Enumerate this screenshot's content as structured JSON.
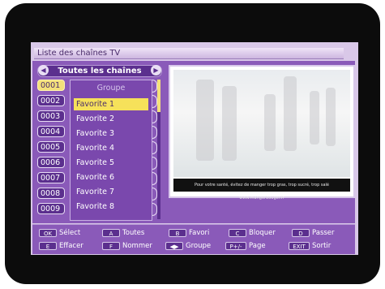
{
  "window": {
    "title": "Liste des chaînes TV"
  },
  "list_header": {
    "title": "Toutes les chaînes",
    "left_arrow": "◀",
    "right_arrow": "▶"
  },
  "channels": [
    "0001",
    "0002",
    "0003",
    "0004",
    "0005",
    "0006",
    "0007",
    "0008",
    "0009"
  ],
  "group_menu": {
    "title": "Groupe",
    "items": [
      "Favorite 1",
      "Favorite 2",
      "Favorite 3",
      "Favorite 4",
      "Favorite 5",
      "Favorite 6",
      "Favorite 7",
      "Favorite 8"
    ],
    "selected": "Favorite 1"
  },
  "preview": {
    "subtitle": "Pour votre santé, évitez de manger trop gras, trop sucré, trop salé www.mangerbouger.fr"
  },
  "footer": {
    "row1": [
      {
        "key": "OK",
        "label": "Sélect"
      },
      {
        "key": "A",
        "label": "Toutes"
      },
      {
        "key": "B",
        "label": "Favori"
      },
      {
        "key": "C",
        "label": "Bloquer"
      },
      {
        "key": "D",
        "label": "Passer"
      }
    ],
    "row2": [
      {
        "key": "E",
        "label": "Effacer"
      },
      {
        "key": "F",
        "label": "Nommer"
      },
      {
        "key": "◀▶",
        "label": "Groupe"
      },
      {
        "key": "P+/-",
        "label": "Page"
      },
      {
        "key": "EXIT",
        "label": "Sortir"
      }
    ]
  },
  "colors": {
    "panel": "#8a5ab9",
    "dark_purple": "#5b2f8e",
    "highlight": "#f6e15a"
  }
}
